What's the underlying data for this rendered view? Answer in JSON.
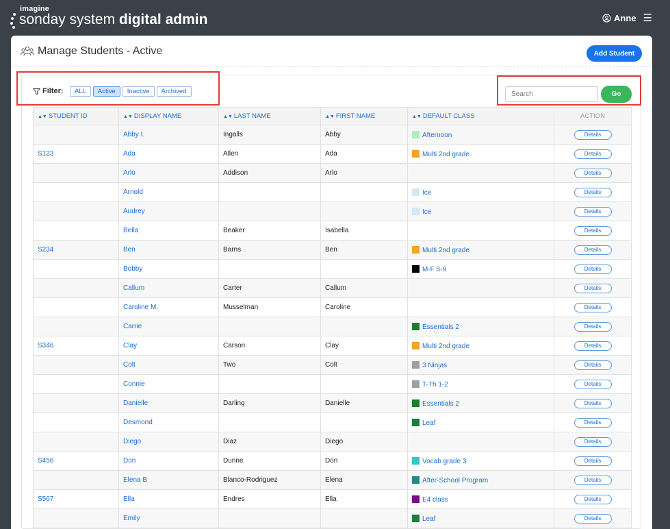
{
  "app": {
    "brand_small": "imagine",
    "brand_name": "sonday system",
    "brand_suffix": "digital admin"
  },
  "user": {
    "name": "Anne"
  },
  "page": {
    "title": "Manage Students - Active",
    "add_button": "Add Student"
  },
  "filter": {
    "label": "Filter:",
    "options": [
      "ALL",
      "Active",
      "Inactive",
      "Archived"
    ],
    "selected": "Active"
  },
  "search": {
    "placeholder": "Search",
    "go_label": "Go"
  },
  "table": {
    "headers": {
      "student_id": "STUDENT ID",
      "display_name": "DISPLAY NAME",
      "last_name": "LAST NAME",
      "first_name": "FIRST NAME",
      "default_class": "DEFAULT CLASS",
      "action": "ACTION"
    },
    "action_label": "Details",
    "rows": [
      {
        "id": "",
        "display": "Abby I.",
        "last": "Ingalls",
        "first": "Abby",
        "class": "Afternoon",
        "color": "#a8efc0"
      },
      {
        "id": "S123",
        "display": "Ada",
        "last": "Allen",
        "first": "Ada",
        "class": "Multi 2nd grade",
        "color": "#f5a32a"
      },
      {
        "id": "",
        "display": "Arlo",
        "last": "Addison",
        "first": "Arlo",
        "class": "",
        "color": ""
      },
      {
        "id": "",
        "display": "Arnold",
        "last": "",
        "first": "",
        "class": "Ice",
        "color": "#d3e7f8"
      },
      {
        "id": "",
        "display": "Audrey",
        "last": "",
        "first": "",
        "class": "Ice",
        "color": "#d3e7f8"
      },
      {
        "id": "",
        "display": "Bella",
        "last": "Beaker",
        "first": "Isabella",
        "class": "",
        "color": ""
      },
      {
        "id": "S234",
        "display": "Ben",
        "last": "Barns",
        "first": "Ben",
        "class": "Multi 2nd grade",
        "color": "#f5a32a"
      },
      {
        "id": "",
        "display": "Bobby",
        "last": "",
        "first": "",
        "class": "M-F 8-9",
        "color": "#000000"
      },
      {
        "id": "",
        "display": "Callum",
        "last": "Carter",
        "first": "Callum",
        "class": "",
        "color": ""
      },
      {
        "id": "",
        "display": "Caroline M.",
        "last": "Musselman",
        "first": "Caroline",
        "class": "",
        "color": ""
      },
      {
        "id": "",
        "display": "Carrie",
        "last": "",
        "first": "",
        "class": "Essentials 2",
        "color": "#1e7e2c"
      },
      {
        "id": "S346",
        "display": "Clay",
        "last": "Carson",
        "first": "Clay",
        "class": "Multi 2nd grade",
        "color": "#f5a32a"
      },
      {
        "id": "",
        "display": "Colt",
        "last": "Two",
        "first": "Colt",
        "class": "3 Ninjas",
        "color": "#a0a0a0"
      },
      {
        "id": "",
        "display": "Connie",
        "last": "",
        "first": "",
        "class": "T-Th 1-2",
        "color": "#a0a0a0"
      },
      {
        "id": "",
        "display": "Danielle",
        "last": "Darling",
        "first": "Danielle",
        "class": "Essentials 2",
        "color": "#1e7e2c"
      },
      {
        "id": "",
        "display": "Desmond",
        "last": "",
        "first": "",
        "class": "Leaf",
        "color": "#1e7e3e"
      },
      {
        "id": "",
        "display": "Diego",
        "last": "Diaz",
        "first": "Diego",
        "class": "",
        "color": ""
      },
      {
        "id": "S456",
        "display": "Don",
        "last": "Dunne",
        "first": "Don",
        "class": "Vocab grade 3",
        "color": "#2ec9c9"
      },
      {
        "id": "",
        "display": "Elena B",
        "last": "Blanco-Rodriguez",
        "first": "Elena",
        "class": "After-School Program",
        "color": "#1e8a8a"
      },
      {
        "id": "S567",
        "display": "Ella",
        "last": "Endres",
        "first": "Ella",
        "class": "E4 class",
        "color": "#7a0a8a"
      },
      {
        "id": "",
        "display": "Emily",
        "last": "",
        "first": "",
        "class": "Leaf",
        "color": "#1e7e3e"
      }
    ]
  }
}
